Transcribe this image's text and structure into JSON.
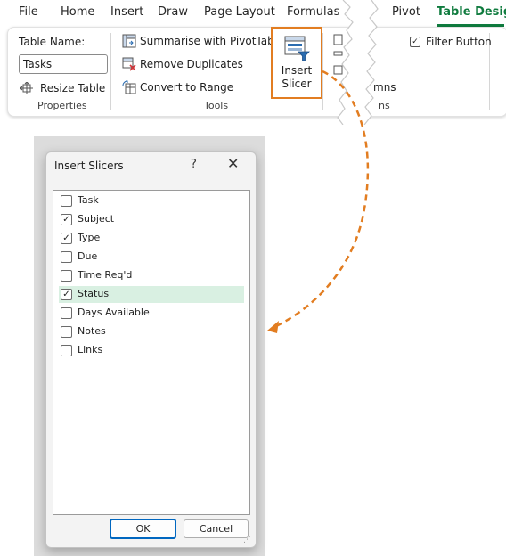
{
  "ribbon_tabs": [
    {
      "label": "File"
    },
    {
      "label": "Home"
    },
    {
      "label": "Insert"
    },
    {
      "label": "Draw"
    },
    {
      "label": "Page Layout"
    },
    {
      "label": "Formulas"
    },
    {
      "label": "Pivot"
    },
    {
      "label": "Table Design",
      "active": true
    }
  ],
  "properties": {
    "table_name_label": "Table Name:",
    "table_name_value": "Tasks",
    "resize_label": "Resize Table",
    "group_label": "Properties"
  },
  "tools": {
    "summarise_label": "Summarise with PivotTable",
    "remove_dup_label": "Remove Duplicates",
    "convert_label": "Convert to Range",
    "group_label": "Tools",
    "insert_slicer_line1": "Insert",
    "insert_slicer_line2": "Slicer"
  },
  "partial": {
    "columns_fragment": "mns",
    "group_fragment": "ns"
  },
  "style_options": {
    "filter_button_label": "Filter Button",
    "filter_button_checked": true
  },
  "dialog": {
    "title": "Insert Slicers",
    "help": "?",
    "close": "✕",
    "ok_label": "OK",
    "cancel_label": "Cancel",
    "items": [
      {
        "label": "Task",
        "checked": false,
        "selected": false
      },
      {
        "label": "Subject",
        "checked": true,
        "selected": false
      },
      {
        "label": "Type",
        "checked": true,
        "selected": false
      },
      {
        "label": "Due",
        "checked": false,
        "selected": false
      },
      {
        "label": "Time Req'd",
        "checked": false,
        "selected": false
      },
      {
        "label": "Status",
        "checked": true,
        "selected": true
      },
      {
        "label": "Days Available",
        "checked": false,
        "selected": false
      },
      {
        "label": "Notes",
        "checked": false,
        "selected": false
      },
      {
        "label": "Links",
        "checked": false,
        "selected": false
      }
    ]
  },
  "colors": {
    "accent_green": "#0f7b3e",
    "highlight_orange": "#e27d21",
    "selection_bg": "#d9f0e2"
  }
}
